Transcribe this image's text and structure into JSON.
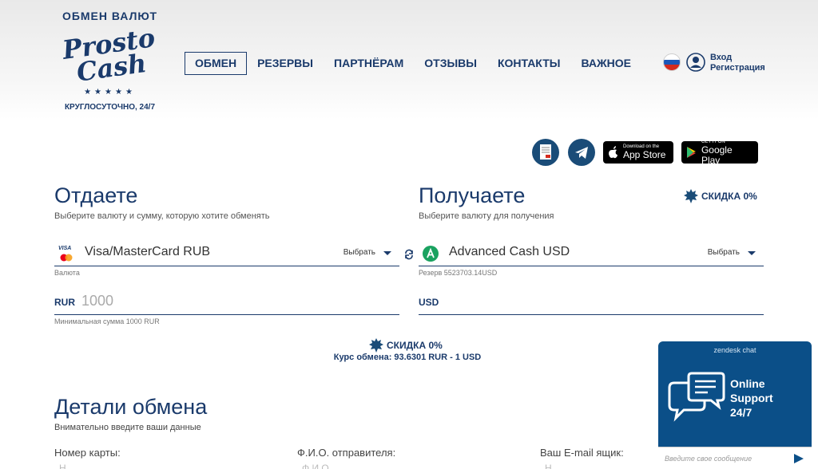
{
  "brand": {
    "top_text": "ОБМЕН ВАЛЮТ",
    "script_line1": "Prosto",
    "script_line2": "Cash",
    "stars": "★★★★★",
    "subtitle": "КРУГЛОСУТОЧНО, 24/7"
  },
  "nav": {
    "items": [
      "ОБМЕН",
      "РЕЗЕРВЫ",
      "ПАРТНЁРАМ",
      "ОТЗЫВЫ",
      "КОНТАКТЫ",
      "ВАЖНОЕ"
    ]
  },
  "auth": {
    "login": "Вход",
    "register": "Регистрация"
  },
  "apps": {
    "appstore_small": "Download on the",
    "appstore_big": "App Store",
    "googleplay_small": "GET IT ON",
    "googleplay_big": "Google Play"
  },
  "give": {
    "title": "Отдаете",
    "hint": "Выберите валюту и сумму, которую хотите обменять",
    "currency": "Visa/MasterCard RUB",
    "pick": "Выбрать",
    "currency_note": "Валюта",
    "amount_label": "RUR",
    "amount_placeholder": "1000",
    "min_note": "Минимальная сумма 1000 RUR",
    "card_logo": "VISA"
  },
  "get": {
    "title": "Получаете",
    "hint": "Выберите валюту для получения",
    "currency": "Advanced Cash USD",
    "pick": "Выбрать",
    "reserve_note": "Резерв 5523703.14USD",
    "amount_label": "USD",
    "discount": "СКИДКА 0%"
  },
  "center": {
    "discount": "СКИДКА 0%",
    "rate": "Курс обмена: 93.6301 RUR - 1 USD"
  },
  "details": {
    "title": "Детали обмена",
    "hint": "Внимательно введите ваши данные",
    "card_label": "Номер карты:",
    "name_label": "Ф.И.О. отправителя:",
    "email_label": "Ваш E-mail ящик:",
    "card_ph": "Н",
    "name_ph": "Ф.И.О.",
    "email_ph": "Н"
  },
  "chat": {
    "provider": "zendesk chat",
    "line1": "Online",
    "line2": "Support",
    "line3": "24/7",
    "placeholder": "Введите свое сообщение"
  },
  "colors": {
    "primary": "#1a3a6b",
    "chat": "#0b4f88"
  }
}
